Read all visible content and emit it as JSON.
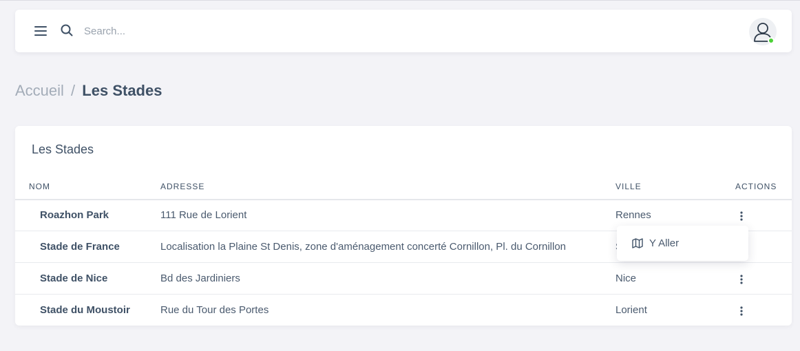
{
  "header": {
    "search_placeholder": "Search...",
    "status_color": "#4cd137"
  },
  "breadcrumb": {
    "home": "Accueil",
    "separator": "/",
    "current": "Les Stades"
  },
  "card": {
    "title": "Les Stades",
    "columns": [
      "NOM",
      "ADRESSE",
      "VILLE",
      "ACTIONS"
    ],
    "rows": [
      {
        "name": "Roazhon Park",
        "address": "111 Rue de Lorient",
        "city": "Rennes"
      },
      {
        "name": "Stade de France",
        "address": "Localisation la Plaine St Denis, zone d'aménagement concerté Cornillon, Pl. du Cornillon",
        "city": "S"
      },
      {
        "name": "Stade de Nice",
        "address": "Bd des Jardiniers",
        "city": "Nice"
      },
      {
        "name": "Stade du Moustoir",
        "address": "Rue du Tour des Portes",
        "city": "Lorient"
      }
    ]
  },
  "dropdown": {
    "item_label": "Y Aller",
    "item_icon": "map-icon"
  },
  "icons": {
    "menu": "menu-icon",
    "search": "search-icon",
    "user": "user-icon",
    "kebab": "kebab-menu-icon"
  }
}
